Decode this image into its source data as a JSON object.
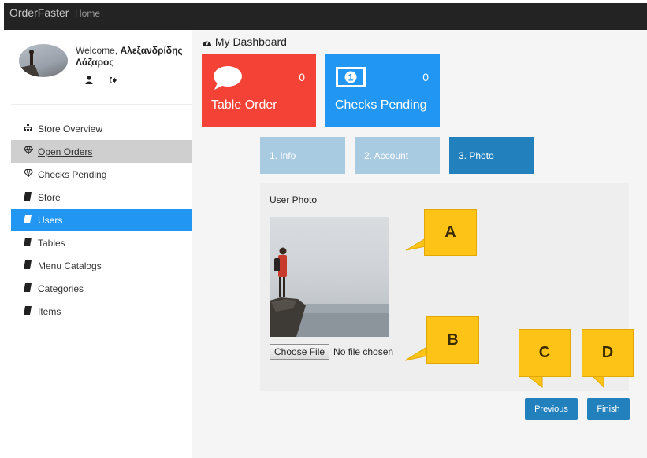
{
  "topnav": {
    "brand": "OrderFaster",
    "home": "Home"
  },
  "user": {
    "welcome_prefix": "Welcome,",
    "name_line1": "Αλεξανδρίδης",
    "name_line2": "Λάζαρος"
  },
  "sidebar": {
    "items": [
      {
        "label": "Store Overview",
        "icon": "sitemap-icon"
      },
      {
        "label": "Open Orders",
        "icon": "diamond-icon"
      },
      {
        "label": "Checks Pending",
        "icon": "diamond-icon"
      },
      {
        "label": "Store",
        "icon": "book-icon"
      },
      {
        "label": "Users",
        "icon": "book-icon"
      },
      {
        "label": "Tables",
        "icon": "book-icon"
      },
      {
        "label": "Menu Catalogs",
        "icon": "book-icon"
      },
      {
        "label": "Categories",
        "icon": "book-icon"
      },
      {
        "label": "Items",
        "icon": "book-icon"
      }
    ]
  },
  "dashboard": {
    "title": "My Dashboard",
    "cards": [
      {
        "label": "Table Order",
        "count": "0",
        "color": "#f44336"
      },
      {
        "label": "Checks Pending",
        "count": "0",
        "color": "#2196f3"
      }
    ]
  },
  "wizard": {
    "steps": [
      "1. Info",
      "2. Account",
      "3. Photo"
    ],
    "panel_title": "User Photo",
    "choose_file": "Choose File",
    "no_file": "No file chosen",
    "previous": "Previous",
    "finish": "Finish"
  },
  "callouts": {
    "a": "A",
    "b": "B",
    "c": "C",
    "d": "D"
  },
  "colors": {
    "accent": "#2196f3",
    "button": "#2280bd",
    "danger": "#f44336",
    "callout": "#fdc317"
  }
}
